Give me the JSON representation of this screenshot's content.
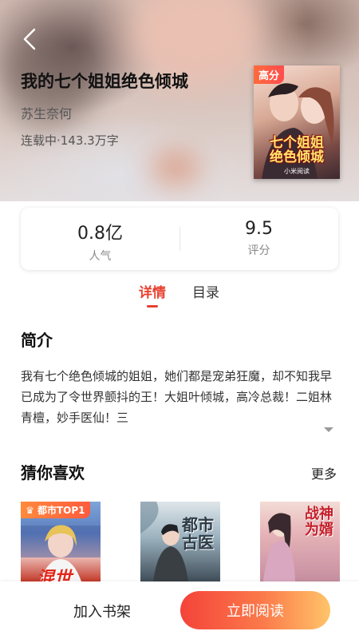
{
  "book": {
    "title": "我的七个姐姐绝色倾城",
    "author": "苏生奈何",
    "status_words": "连载中·143.3万字",
    "cover_badge": "高分",
    "cover_title_line1": "七个姐姐",
    "cover_title_line2": "绝色倾城",
    "cover_publisher": "小米阅读"
  },
  "stats": [
    {
      "value": "0.8亿",
      "label": "人气"
    },
    {
      "value": "9.5",
      "label": "评分"
    }
  ],
  "tabs": [
    {
      "label": "详情",
      "active": true
    },
    {
      "label": "目录",
      "active": false
    }
  ],
  "intro": {
    "heading": "简介",
    "text": "我有七个绝色倾城的姐姐，她们都是宠弟狂魔，却不知我早已成为了令世界颤抖的王！大姐叶倾城，高冷总裁！二姐林青檀，妙手医仙！三"
  },
  "recommend": {
    "heading": "猜你喜欢",
    "more_label": "更多",
    "items": [
      {
        "badge": "都市TOP1",
        "cover_text": "混世"
      },
      {
        "cover_text": "都市古医"
      },
      {
        "cover_text": "战神为婿"
      }
    ]
  },
  "bottom_bar": {
    "add_shelf_label": "加入书架",
    "read_label": "立即阅读"
  },
  "colors": {
    "accent": "#e8402f",
    "read_gradient_start": "#f4433a",
    "read_gradient_end": "#ffc46a"
  },
  "icons": [
    "back-arrow-icon",
    "chevron-down-icon",
    "crown-icon"
  ]
}
